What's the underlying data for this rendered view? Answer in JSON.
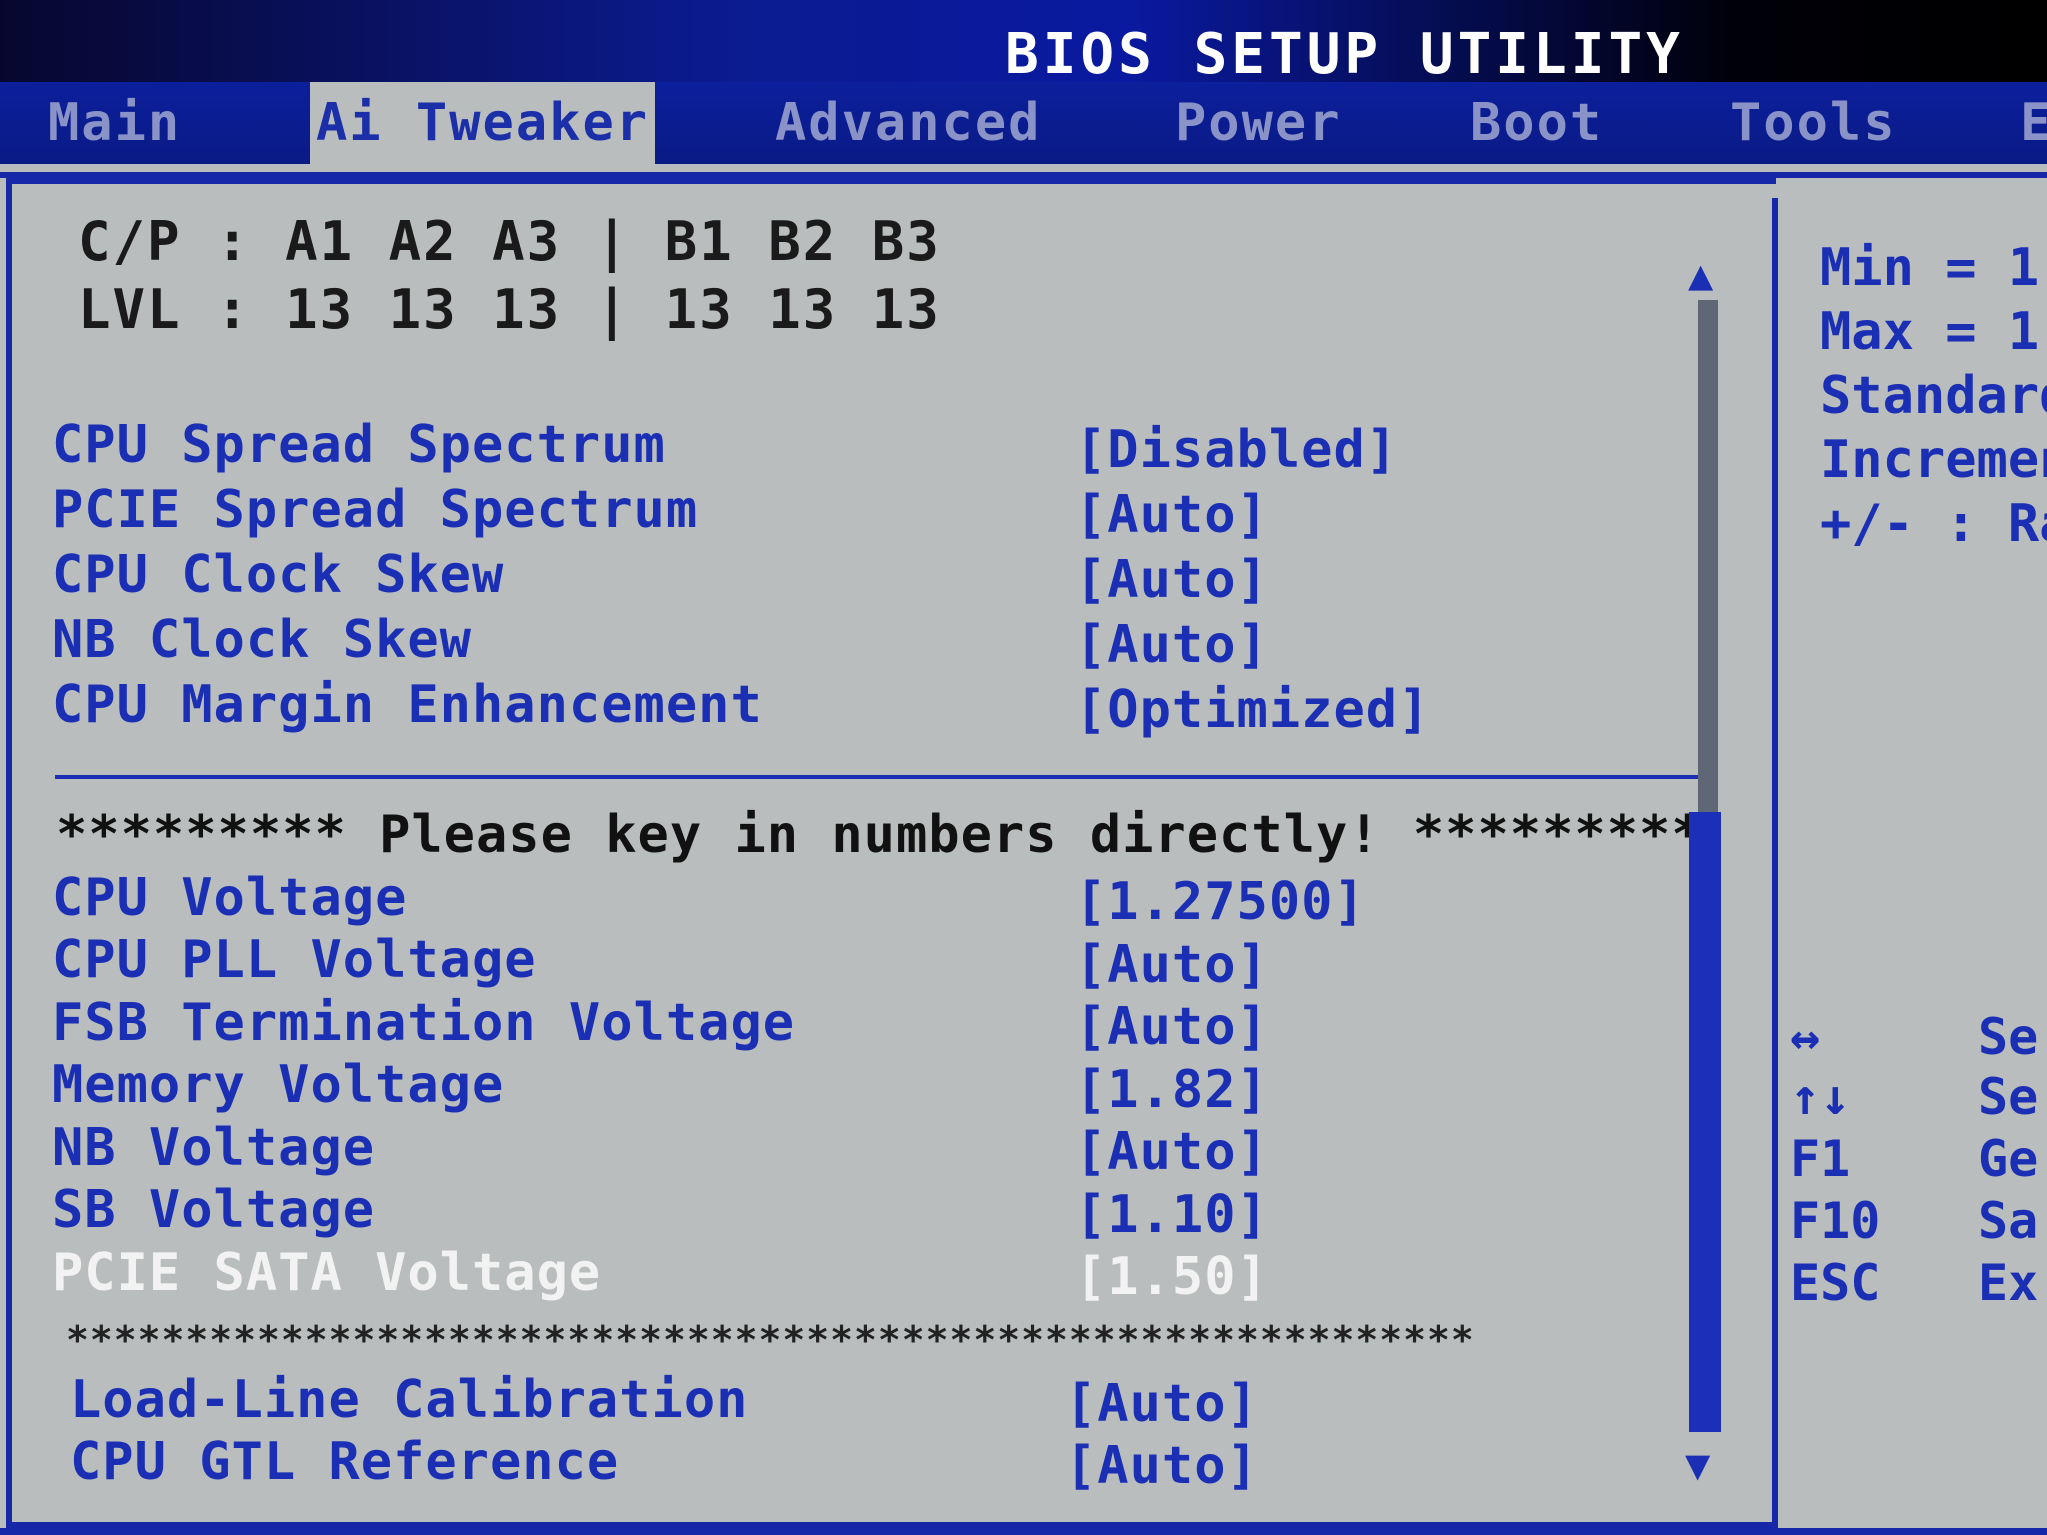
{
  "title": "BIOS SETUP UTILITY",
  "tabs": [
    {
      "label": "Main"
    },
    {
      "label": "Ai Tweaker",
      "active": true
    },
    {
      "label": "Advanced"
    },
    {
      "label": "Power"
    },
    {
      "label": "Boot"
    },
    {
      "label": "Tools"
    },
    {
      "label": "E"
    }
  ],
  "cp_table": {
    "row1": "C/P : A1 A2 A3 | B1 B2 B3",
    "row2": "LVL : 13 13 13 | 13 13 13"
  },
  "settings_group1": [
    {
      "label": "CPU Spread Spectrum",
      "value": "[Disabled]"
    },
    {
      "label": "PCIE Spread Spectrum",
      "value": "[Auto]"
    },
    {
      "label": "CPU Clock Skew",
      "value": "[Auto]"
    },
    {
      "label": "NB Clock Skew",
      "value": "[Auto]"
    },
    {
      "label": "CPU Margin Enhancement",
      "value": "[Optimized]"
    }
  ],
  "note": "********* Please key in numbers directly! *********",
  "settings_group2": [
    {
      "label": "CPU Voltage",
      "value": "[1.27500]"
    },
    {
      "label": "CPU PLL Voltage",
      "value": "[Auto]"
    },
    {
      "label": "FSB Termination Voltage",
      "value": "[Auto]"
    },
    {
      "label": "Memory Voltage",
      "value": "[1.82]"
    },
    {
      "label": "NB Voltage",
      "value": "[Auto]"
    },
    {
      "label": "SB Voltage",
      "value": "[1.10]"
    },
    {
      "label": "PCIE SATA Voltage",
      "value": "[1.50]",
      "selected": true
    }
  ],
  "stars_line": "***********************************************************",
  "settings_group3": [
    {
      "label": "Load-Line Calibration",
      "value": "[Auto]"
    },
    {
      "label": "CPU GTL Reference",
      "value": "[Auto]"
    }
  ],
  "help": {
    "lines": [
      "Min = 1",
      "Max = 1",
      "Standard",
      "Incremen",
      "+/- : Ra"
    ]
  },
  "keys": [
    {
      "key": "↔",
      "desc": "Se"
    },
    {
      "key": "↑↓",
      "desc": "Se"
    },
    {
      "key": "F1",
      "desc": "Ge"
    },
    {
      "key": "F10",
      "desc": "Sa"
    },
    {
      "key": "ESC",
      "desc": "Ex"
    }
  ],
  "scroll": {
    "up_icon": "▲",
    "down_icon": "▼"
  },
  "colors": {
    "background": "#b9bdbd",
    "accent_blue": "#1a2fb4",
    "highlight": "#f2f2f2"
  }
}
